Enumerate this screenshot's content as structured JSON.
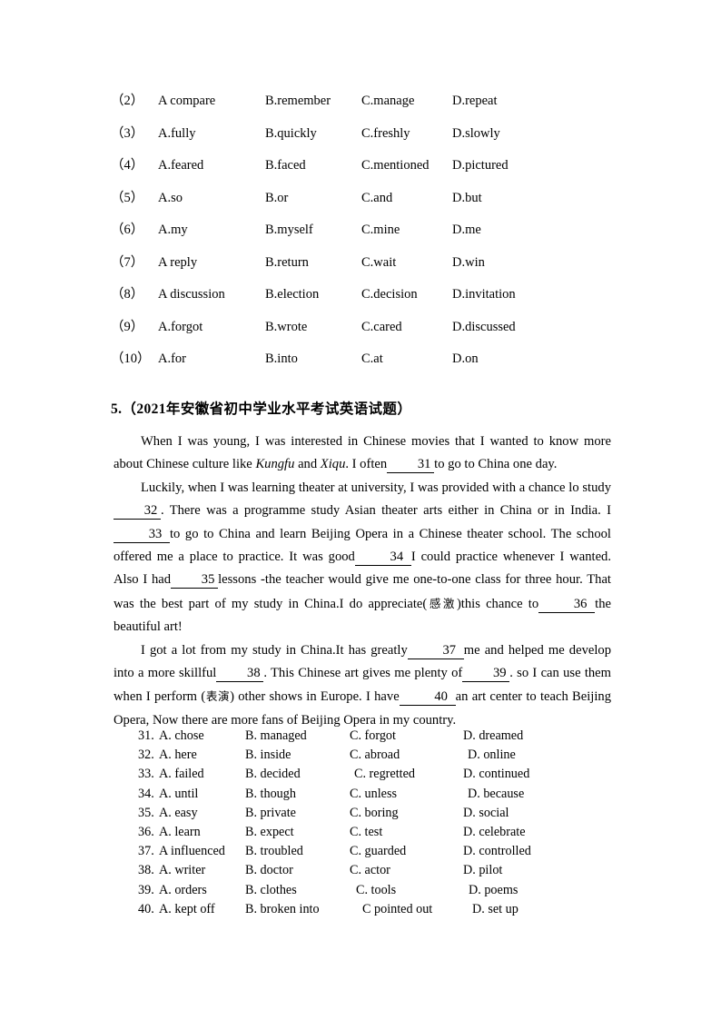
{
  "top_choices": {
    "rows": [
      {
        "num": "（2）",
        "a": "A compare",
        "b": "B.remember",
        "c": "C.manage",
        "d": "D.repeat"
      },
      {
        "num": "（3）",
        "a": "A.fully",
        "b": "B.quickly",
        "c": "C.freshly",
        "d": "D.slowly"
      },
      {
        "num": "（4）",
        "a": "A.feared",
        "b": "B.faced",
        "c": "C.mentioned",
        "d": "D.pictured"
      },
      {
        "num": "（5）",
        "a": "A.so",
        "b": "B.or",
        "c": "C.and",
        "d": "D.but"
      },
      {
        "num": "（6）",
        "a": "A.my",
        "b": "B.myself",
        "c": "C.mine",
        "d": "D.me"
      },
      {
        "num": "（7）",
        "a": "A reply",
        "b": "B.return",
        "c": "C.wait",
        "d": "D.win"
      },
      {
        "num": "（8）",
        "a": "A discussion",
        "b": "B.election",
        "c": "C.decision",
        "d": "D.invitation"
      },
      {
        "num": "（9）",
        "a": "A.forgot",
        "b": "B.wrote",
        "c": "C.cared",
        "d": "D.discussed"
      },
      {
        "num": "（10）",
        "a": "A.for",
        "b": "B.into",
        "c": "C.at",
        "d": "D.on"
      }
    ]
  },
  "section": {
    "heading": "5.（2021年安徽省初中学业水平考试英语试题）"
  },
  "passage": {
    "p1": {
      "seg1": "When I was young, I was interested in Chinese movies that I wanted to know more about Chinese culture like ",
      "italic1": "Kungfu",
      "seg2": " and ",
      "italic2": "Xiqu",
      "seg3": ". I often",
      "blank31": "31",
      "seg4": "to go to China one day."
    },
    "p2": {
      "seg1": "Luckily, when I was learning theater at university, I was provided with a chance lo study",
      "blank32": "32 ",
      "seg2": ". There was a programme study Asian theater arts either in China or in India. I",
      "blank33": "33",
      "seg3": "to go to China and learn Beijing Opera in a Chinese theater school. The school offered me a place to   practice. It was good",
      "blank34": "34",
      "seg4": "I could practice whenever I wanted. Also I had",
      "blank35": "35",
      "seg5": "lessons -the teacher would give me one-to-one class for three hour. That was the best part of my study in China.I do appreciate(",
      "cn1": "感激",
      "seg6": ")this chance to",
      "blank36": "36",
      "seg7": "the beautiful art!"
    },
    "p3": {
      "seg1": "I got a lot from my study in China.It has greatly",
      "blank37": "37",
      "seg2": "me and helped me develop into a more skillful",
      "blank38": "38 ",
      "seg3": ". This Chinese art gives me plenty of",
      "blank39": "39 ",
      "seg4": ". so I can use them when I perform (",
      "cn2": "表演",
      "seg5": ") other shows in Europe. I have",
      "blank40": "40",
      "seg6": "an art center to teach Beijing Opera, Now there are more fans of Beijing Opera in my country."
    }
  },
  "bottom_choices": {
    "rows": [
      {
        "num": "31.",
        "a": "A. chose",
        "b": "B. managed",
        "c": "C. forgot",
        "d": "D. dreamed"
      },
      {
        "num": "32.",
        "a": "A. here",
        "b": "B. inside",
        "c": "C. abroad",
        "d": "D. online"
      },
      {
        "num": "33.",
        "a": "A. failed",
        "b": "B. decided",
        "c": "C. regretted",
        "d": "D. continued"
      },
      {
        "num": "34.",
        "a": "A. until",
        "b": "B. though",
        "c": "C. unless",
        "d": "D. because"
      },
      {
        "num": "35.",
        "a": "A. easy",
        "b": "B. private",
        "c": "C. boring",
        "d": "D. social"
      },
      {
        "num": "36.",
        "a": "A. learn",
        "b": "B. expect",
        "c": "C. test",
        "d": "D. celebrate"
      },
      {
        "num": "37.",
        "a": "A influenced",
        "b": "B. troubled",
        "c": "C. guarded",
        "d": "D. controlled"
      },
      {
        "num": "38.",
        "a": "A. writer",
        "b": "B. doctor",
        "c": "C. actor",
        "d": "D. pilot"
      },
      {
        "num": "39.",
        "a": "A. orders",
        "b": "B. clothes",
        "c": "C. tools",
        "d": "D. poems"
      },
      {
        "num": "40.",
        "a": "A. kept off",
        "b": "B. broken into",
        "c": "C pointed out",
        "d": "D. set up"
      }
    ]
  }
}
